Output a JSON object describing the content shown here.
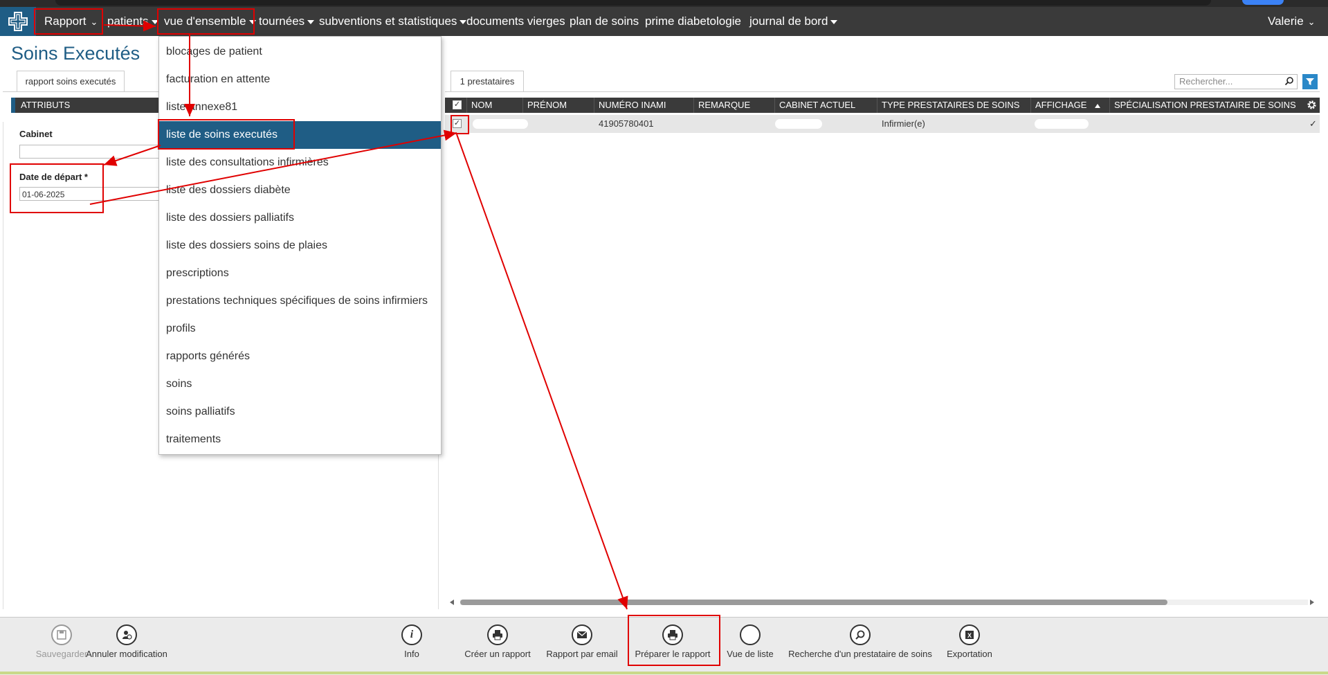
{
  "nav": {
    "rapport": "Rapport",
    "items": [
      {
        "label": "patients",
        "caret": true
      },
      {
        "label": "vue d'ensemble",
        "caret": true
      },
      {
        "label": "tournées",
        "caret": true
      },
      {
        "label": "subventions et statistiques",
        "caret": true
      },
      {
        "label": "documents vierges",
        "caret": false
      },
      {
        "label": "plan de soins",
        "caret": false
      },
      {
        "label": "prime diabetologie",
        "caret": false
      },
      {
        "label": "journal de bord",
        "caret": true
      }
    ],
    "user": "Valerie"
  },
  "page": {
    "title": "Soins Executés",
    "left_tab": "rapport soins executés",
    "attributes_header": "ATTRIBUTS",
    "cabinet_label": "Cabinet",
    "cabinet_value": "",
    "date_label": "Date de départ *",
    "date_value": "01-06-2025"
  },
  "dropdown": {
    "items": [
      "blocages de patient",
      "facturation en attente",
      "liste annexe81",
      "liste de soins executés",
      "liste des consultations infirmières",
      "liste des dossiers diabète",
      "liste des dossiers palliatifs",
      "liste des dossiers soins de plaies",
      "prescriptions",
      "prestations techniques spécifiques de soins infirmiers",
      "profils",
      "rapports générés",
      "soins",
      "soins palliatifs",
      "traitements"
    ],
    "active": "liste de soins executés"
  },
  "grid": {
    "tab": "1 prestataires",
    "search_placeholder": "Rechercher...",
    "columns": [
      "NOM",
      "PRÉNOM",
      "NUMÉRO INAMI",
      "REMARQUE",
      "CABINET ACTUEL",
      "TYPE PRESTATAIRES DE SOINS",
      "AFFICHAGE",
      "SPÉCIALISATION PRESTATAIRE DE SOINS"
    ],
    "rows": [
      {
        "nom": "",
        "prenom": "",
        "inami": "41905780401",
        "remarque": "",
        "cabinet": "",
        "type": "Infirmier(e)",
        "affichage": "",
        "specialisation": "",
        "checked": true,
        "tick": "✓"
      }
    ]
  },
  "toolbar": {
    "save": "Sauvegarder",
    "cancel": "Annuler modification",
    "info": "Info",
    "create": "Créer un rapport",
    "email": "Rapport par email",
    "prepare": "Préparer le rapport",
    "listview": "Vue de liste",
    "search": "Recherche d'un prestataire de soins",
    "export": "Exportation"
  },
  "colors": {
    "brand": "#1f5d85",
    "navbar": "#3a3a3a",
    "annotation": "#e00000"
  }
}
